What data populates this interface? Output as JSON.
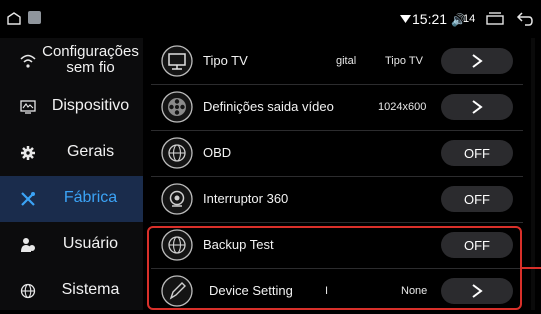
{
  "status": {
    "time": "15:21",
    "volume": "14"
  },
  "sidebar": {
    "items": [
      {
        "label": "Configurações sem fio",
        "icon": "wifi-icon",
        "active": false
      },
      {
        "label": "Dispositivo",
        "icon": "device-icon",
        "active": false
      },
      {
        "label": "Gerais",
        "icon": "gear-icon",
        "active": false
      },
      {
        "label": "Fábrica",
        "icon": "tools-icon",
        "active": true
      },
      {
        "label": "Usuário",
        "icon": "user-icon",
        "active": false
      },
      {
        "label": "Sistema",
        "icon": "globe-icon",
        "active": false
      }
    ]
  },
  "rows": [
    {
      "label": "Tipo TV",
      "values": [
        "gital",
        "Tipo TV"
      ],
      "control": "chevron"
    },
    {
      "label": "Definições saida vídeo",
      "values": [
        "1024x600"
      ],
      "control": "chevron"
    },
    {
      "label": "OBD",
      "values": [],
      "control": "OFF"
    },
    {
      "label": "Interruptor 360",
      "values": [],
      "control": "OFF"
    },
    {
      "label": "Backup Test",
      "values": [],
      "control": "OFF"
    },
    {
      "label": "Device Setting",
      "values": [
        "I",
        "None"
      ],
      "control": "chevron"
    }
  ],
  "colors": {
    "accent": "#3ba3f6",
    "active_bg": "#1a2c4c",
    "highlight": "#d9302a"
  }
}
